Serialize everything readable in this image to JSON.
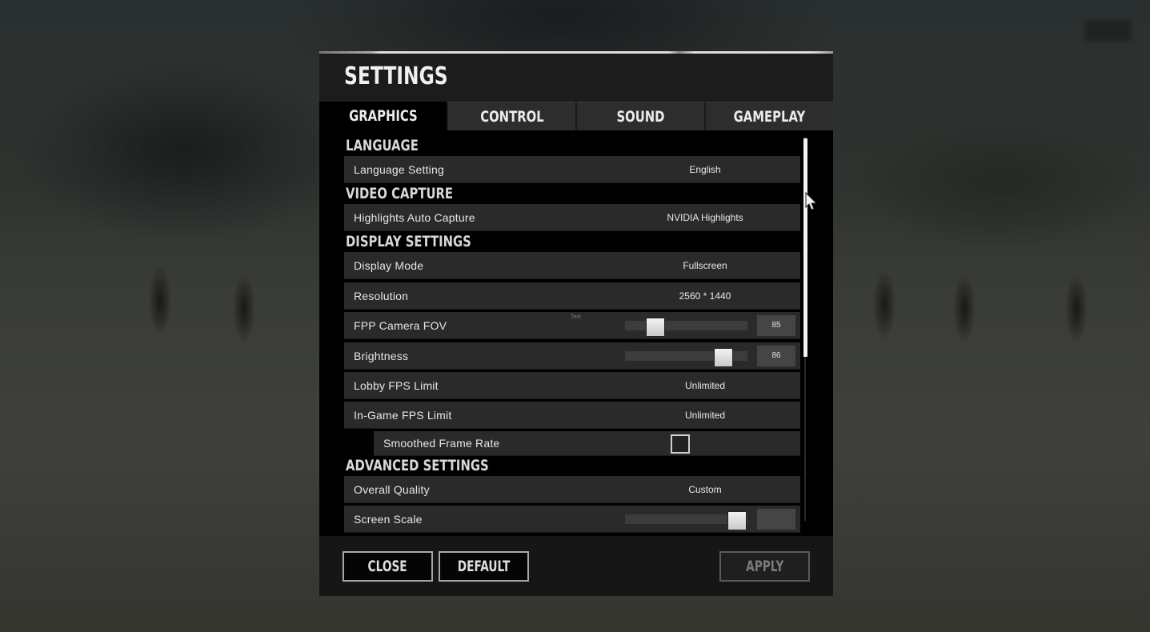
{
  "window": {
    "title": "SETTINGS"
  },
  "tabs": [
    {
      "label": "GRAPHICS",
      "active": true
    },
    {
      "label": "CONTROL",
      "active": false
    },
    {
      "label": "SOUND",
      "active": false
    },
    {
      "label": "GAMEPLAY",
      "active": false
    }
  ],
  "sections": {
    "language": {
      "title": "LANGUAGE",
      "language_setting": {
        "label": "Language Setting",
        "value": "English"
      }
    },
    "video_capture": {
      "title": "VIDEO CAPTURE",
      "highlights_auto_capture": {
        "label": "Highlights Auto Capture",
        "value": "NVIDIA Highlights"
      }
    },
    "display_settings": {
      "title": "DISPLAY SETTINGS",
      "display_mode": {
        "label": "Display Mode",
        "value": "Fullscreen"
      },
      "resolution": {
        "label": "Resolution",
        "value": "2560 * 1440"
      },
      "fpp_camera_fov": {
        "label": "FPP Camera FOV",
        "hint": "Text",
        "value": "85",
        "slider_fraction": 0.2
      },
      "brightness": {
        "label": "Brightness",
        "value": "86",
        "slider_fraction": 0.86
      },
      "lobby_fps_limit": {
        "label": "Lobby FPS Limit",
        "value": "Unlimited"
      },
      "ingame_fps_limit": {
        "label": "In-Game FPS Limit",
        "value": "Unlimited"
      },
      "smoothed_frame_rate": {
        "label": "Smoothed Frame Rate",
        "checked": false
      }
    },
    "advanced_settings": {
      "title": "ADVANCED SETTINGS",
      "overall_quality": {
        "label": "Overall Quality",
        "value": "Custom"
      },
      "screen_scale": {
        "label": "Screen Scale",
        "slider_fraction": 0.99
      }
    }
  },
  "scroll": {
    "position_fraction": 0.0,
    "visible_fraction": 0.57
  },
  "footer": {
    "close_label": "CLOSE",
    "default_label": "DEFAULT",
    "apply_label": "APPLY",
    "apply_enabled": false
  }
}
